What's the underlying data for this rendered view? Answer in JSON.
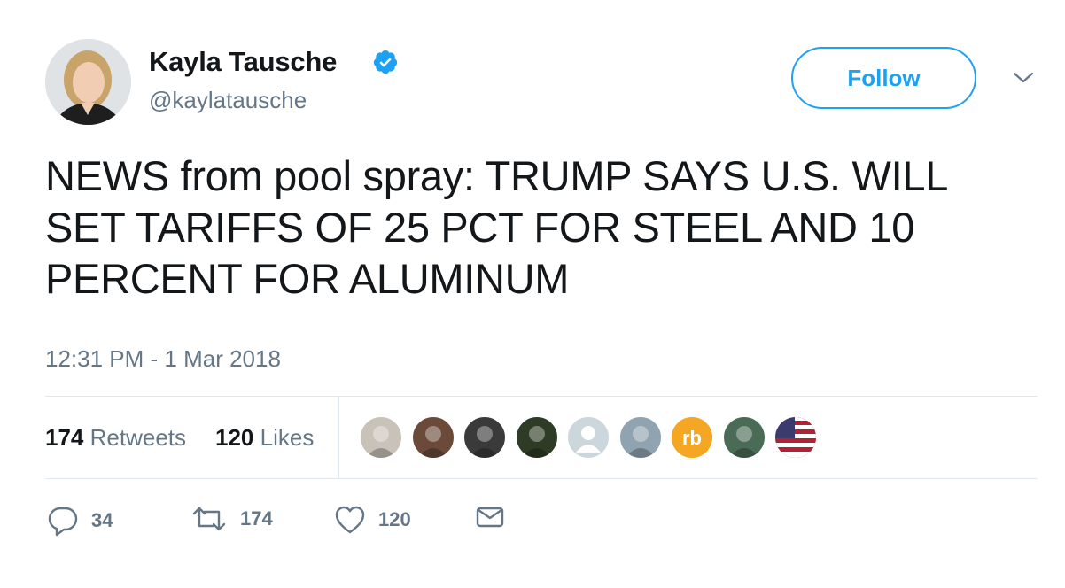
{
  "author": {
    "display_name": "Kayla Tausche",
    "handle": "@kaylatausche",
    "verified": true
  },
  "follow_button": {
    "label": "Follow"
  },
  "tweet": {
    "text": "NEWS from pool spray: TRUMP SAYS U.S. WILL SET TARIFFS OF 25 PCT FOR STEEL AND 10 PERCENT FOR ALUMINUM",
    "timestamp": "12:31 PM - 1 Mar 2018"
  },
  "stats": {
    "retweets_count": "174",
    "retweets_label": "Retweets",
    "likes_count": "120",
    "likes_label": "Likes"
  },
  "likers": [
    {
      "name": "liker-avatar-1",
      "color": "#c9c2b8"
    },
    {
      "name": "liker-avatar-2",
      "color": "#6b4a3a"
    },
    {
      "name": "liker-avatar-3",
      "color": "#3a3a3a"
    },
    {
      "name": "liker-avatar-4",
      "color": "#2e3b25"
    },
    {
      "name": "liker-avatar-5",
      "color": "#ccd6dd"
    },
    {
      "name": "liker-avatar-6",
      "color": "#8fa3b0"
    },
    {
      "name": "liker-avatar-7",
      "color": "#f5a623"
    },
    {
      "name": "liker-avatar-8",
      "color": "#4a6b55"
    },
    {
      "name": "liker-avatar-9",
      "color": "#b22234"
    }
  ],
  "actions": {
    "reply_count": "34",
    "retweet_count": "174",
    "like_count": "120"
  },
  "icons": {
    "verified": "verified-badge-icon",
    "caret": "chevron-down-icon",
    "reply": "reply-icon",
    "retweet": "retweet-icon",
    "like": "heart-icon",
    "dm": "envelope-icon"
  },
  "colors": {
    "accent": "#1da1f2",
    "muted_text": "#657786",
    "text": "#14171a",
    "divider": "#e1e8ed"
  }
}
